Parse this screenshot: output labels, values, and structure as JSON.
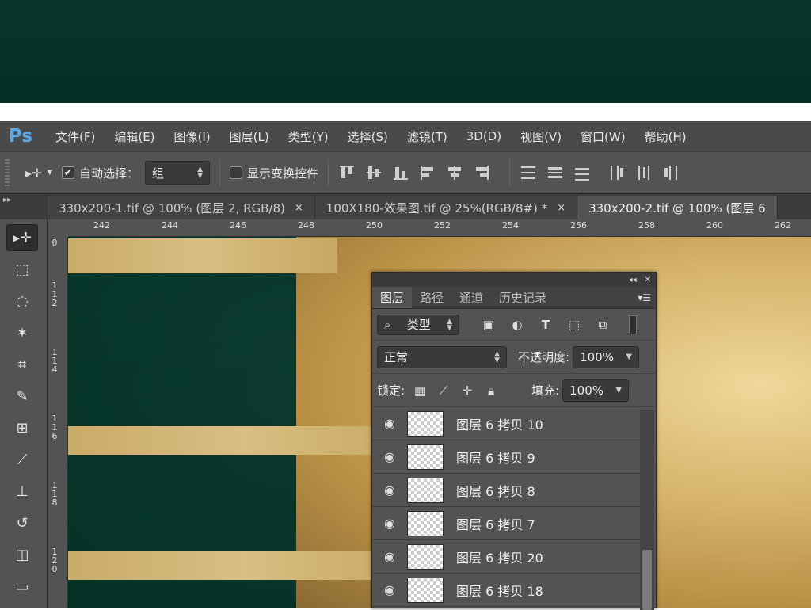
{
  "app": {
    "logo": "Ps"
  },
  "menu": [
    "文件(F)",
    "编辑(E)",
    "图像(I)",
    "图层(L)",
    "类型(Y)",
    "选择(S)",
    "滤镜(T)",
    "3D(D)",
    "视图(V)",
    "窗口(W)",
    "帮助(H)"
  ],
  "options": {
    "auto_select_label": "自动选择：",
    "auto_select_checked": true,
    "auto_select_value": "组",
    "show_transform_label": "显示变换控件",
    "show_transform_checked": false
  },
  "tabs": [
    {
      "label": "330x200-1.tif @ 100% (图层 2, RGB/8)",
      "close": "×",
      "active": false
    },
    {
      "label": "100X180-效果图.tif @ 25%(RGB/8#) *",
      "close": "×",
      "active": false
    },
    {
      "label": "330x200-2.tif @ 100% (图层 6",
      "close": "",
      "active": true
    }
  ],
  "ruler": {
    "h_labels": [
      "242",
      "244",
      "246",
      "248",
      "250",
      "252",
      "254",
      "256",
      "258",
      "260",
      "262"
    ],
    "v_labels": [
      "0",
      "1\n1\n2",
      "1\n1\n4",
      "1\n1\n6",
      "1\n1\n8",
      "1\n2\n0"
    ]
  },
  "tools": [
    {
      "name": "move-tool",
      "glyph": "▸✛",
      "active": true
    },
    {
      "name": "marquee-tool",
      "glyph": "⬚"
    },
    {
      "name": "lasso-tool",
      "glyph": "◌"
    },
    {
      "name": "magic-wand-tool",
      "glyph": "✶"
    },
    {
      "name": "crop-tool",
      "glyph": "⌗"
    },
    {
      "name": "eyedropper-tool",
      "glyph": "✎"
    },
    {
      "name": "healing-tool",
      "glyph": "⊞"
    },
    {
      "name": "brush-tool",
      "glyph": "⟋"
    },
    {
      "name": "stamp-tool",
      "glyph": "⊥"
    },
    {
      "name": "history-brush-tool",
      "glyph": "↺"
    },
    {
      "name": "eraser-tool",
      "glyph": "◫"
    },
    {
      "name": "gradient-tool",
      "glyph": "▭"
    }
  ],
  "layers_panel": {
    "tabs": [
      "图层",
      "路径",
      "通道",
      "历史记录"
    ],
    "filter_label": "类型",
    "blend_mode": "正常",
    "opacity_label": "不透明度:",
    "opacity_value": "100%",
    "lock_label": "锁定:",
    "fill_label": "填充:",
    "fill_value": "100%",
    "layers": [
      {
        "name": "图层 6 拷贝 10"
      },
      {
        "name": "图层 6 拷贝 9"
      },
      {
        "name": "图层 6 拷贝 8"
      },
      {
        "name": "图层 6 拷贝 7"
      },
      {
        "name": "图层 6 拷贝 20"
      },
      {
        "name": "图层 6 拷贝 18"
      }
    ]
  },
  "colors": {
    "canvas_green": "#053529",
    "gold": "#d2b476",
    "ps_blue": "#5aa9e6"
  }
}
